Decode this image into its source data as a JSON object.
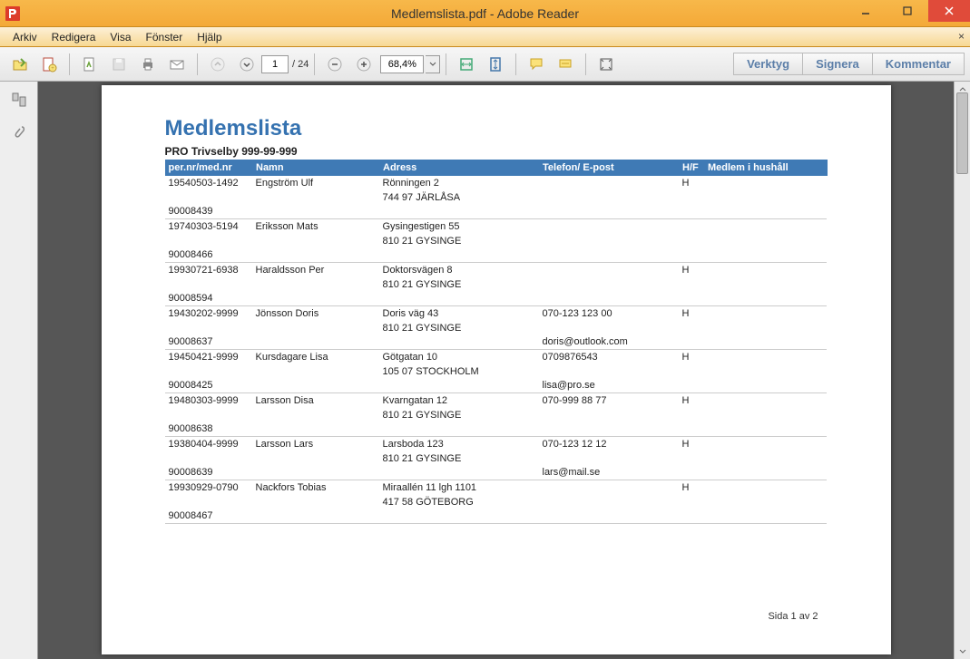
{
  "window": {
    "title": "Medlemslista.pdf - Adobe Reader"
  },
  "menu": {
    "items": [
      "Arkiv",
      "Redigera",
      "Visa",
      "Fönster",
      "Hjälp"
    ],
    "close_x": "×"
  },
  "toolbar": {
    "page_current": "1",
    "page_total": "/ 24",
    "zoom": "68,4%",
    "panels": {
      "tools": "Verktyg",
      "sign": "Signera",
      "comment": "Kommentar"
    }
  },
  "document": {
    "title": "Medlemslista",
    "subtitle": "PRO Trivselby 999-99-999",
    "headers": {
      "pn": "per.nr/med.nr",
      "name": "Namn",
      "address": "Adress",
      "tel": "Telefon/ E-post",
      "hf": "H/F",
      "house": "Medlem i hushåll"
    },
    "rows": [
      {
        "pn": "19540503-1492",
        "name": "Engström Ulf",
        "addr1": "Rönningen 2",
        "addr2": "744 97 JÄRLÅSA",
        "tel": "",
        "email": "",
        "hf": "H",
        "id": "90008439"
      },
      {
        "pn": "19740303-5194",
        "name": "Eriksson Mats",
        "addr1": "Gysingestigen 55",
        "addr2": "810 21 GYSINGE",
        "tel": "",
        "email": "",
        "hf": "",
        "id": "90008466"
      },
      {
        "pn": "19930721-6938",
        "name": "Haraldsson Per",
        "addr1": "Doktorsvägen 8",
        "addr2": "810 21 GYSINGE",
        "tel": "",
        "email": "",
        "hf": "H",
        "id": "90008594"
      },
      {
        "pn": "19430202-9999",
        "name": "Jönsson Doris",
        "addr1": "Doris väg 43",
        "addr2": "810 21 GYSINGE",
        "tel": "070-123 123 00",
        "email": "doris@outlook.com",
        "hf": "H",
        "id": "90008637"
      },
      {
        "pn": "19450421-9999",
        "name": "Kursdagare Lisa",
        "addr1": "Götgatan 10",
        "addr2": "105 07 STOCKHOLM",
        "tel": "0709876543",
        "email": "lisa@pro.se",
        "hf": "H",
        "id": "90008425"
      },
      {
        "pn": "19480303-9999",
        "name": "Larsson Disa",
        "addr1": "Kvarngatan 12",
        "addr2": "810 21 GYSINGE",
        "tel": "070-999 88 77",
        "email": "",
        "hf": "H",
        "id": "90008638"
      },
      {
        "pn": "19380404-9999",
        "name": "Larsson Lars",
        "addr1": "Larsboda 123",
        "addr2": "810 21 GYSINGE",
        "tel": "070-123 12 12",
        "email": "lars@mail.se",
        "hf": "H",
        "id": "90008639"
      },
      {
        "pn": "19930929-0790",
        "name": "Nackfors Tobias",
        "addr1": "Miraallén 11 lgh 1101",
        "addr2": "417 58 GÖTEBORG",
        "tel": "",
        "email": "",
        "hf": "H",
        "id": "90008467"
      }
    ],
    "footer": "Sida 1 av 2"
  }
}
